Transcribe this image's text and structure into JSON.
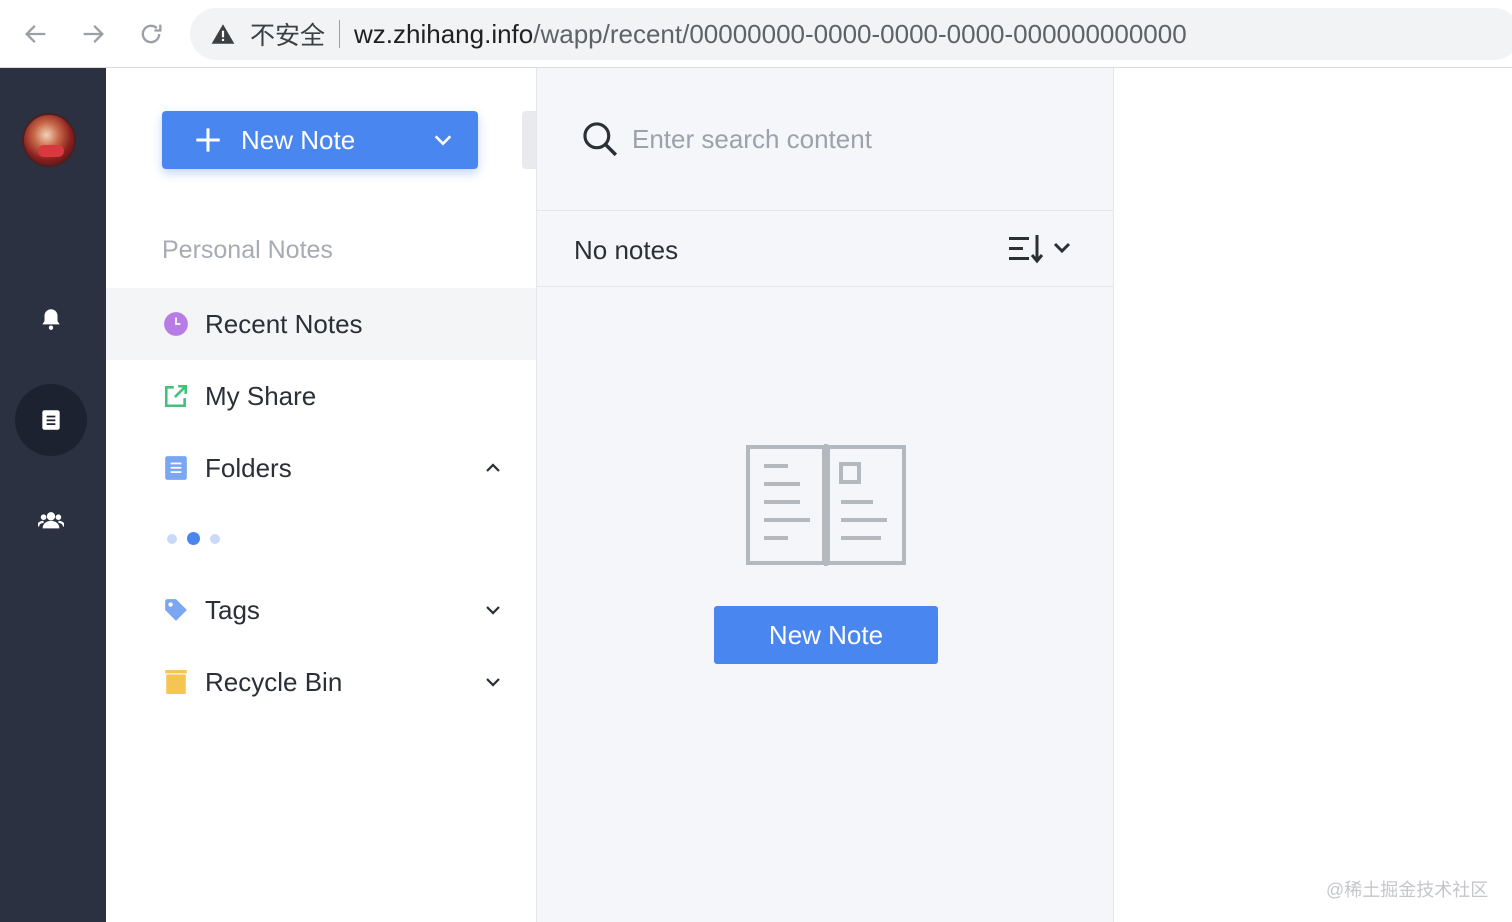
{
  "browser": {
    "insecure_label": "不安全",
    "url_host": "wz.zhihang.info",
    "url_path": "/wapp/recent/00000000-0000-0000-0000-000000000000",
    "icons": [
      "back-arrow-icon",
      "forward-arrow-icon",
      "reload-icon",
      "warning-icon"
    ]
  },
  "rail": {
    "items": [
      {
        "name": "avatar"
      },
      {
        "name": "notifications",
        "icon": "bell-icon"
      },
      {
        "name": "notes",
        "icon": "document-icon",
        "active": true
      },
      {
        "name": "contacts",
        "icon": "users-icon"
      }
    ]
  },
  "sidebar": {
    "new_note_label": "New Note",
    "section_title": "Personal Notes",
    "items": [
      {
        "label": "Recent Notes",
        "icon": "clock-icon",
        "color": "#b77ce6",
        "active": true
      },
      {
        "label": "My Share",
        "icon": "share-icon",
        "color": "#43c07a"
      },
      {
        "label": "Folders",
        "icon": "folder-icon",
        "color": "#7aa6f2",
        "expanded": true
      },
      {
        "label": "Tags",
        "icon": "tag-icon",
        "color": "#7aa6f2",
        "expanded": false
      },
      {
        "label": "Recycle Bin",
        "icon": "trash-icon",
        "color": "#f6c453",
        "expanded": false
      }
    ]
  },
  "list": {
    "search_placeholder": "Enter search content",
    "title": "No notes",
    "empty_button_label": "New Note"
  },
  "watermark": "@稀土掘金技术社区",
  "colors": {
    "primary": "#4a86f0",
    "rail_bg": "#2b3140",
    "panel_bg": "#f5f6fa"
  }
}
